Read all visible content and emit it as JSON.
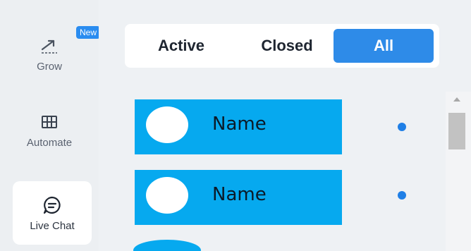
{
  "nav": {
    "grow": {
      "label": "Grow",
      "icon": "trending-up-icon",
      "badge": "New"
    },
    "automate": {
      "label": "Automate",
      "icon": "automation-icon"
    },
    "livechat": {
      "label": "Live Chat",
      "icon": "chat-bubble-icon"
    }
  },
  "tabs": {
    "active": "Active",
    "closed": "Closed",
    "all": "All",
    "selected": "All"
  },
  "conversations": [
    {
      "name": "Name",
      "status": "unread"
    },
    {
      "name": "Name",
      "status": "unread"
    }
  ],
  "colors": {
    "accent": "#2e8be8",
    "item_bg": "#06a9ef",
    "badge": "#2a8cf0",
    "unread_dot": "#1f7fe6"
  }
}
